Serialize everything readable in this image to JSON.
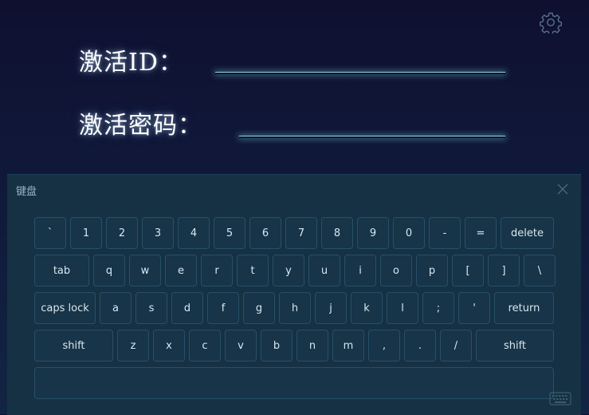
{
  "form": {
    "activation_id_label": "激活ID：",
    "activation_password_label": "激活密码：",
    "activation_id_value": "",
    "activation_password_value": ""
  },
  "icons": {
    "settings": "gear-icon",
    "close": "close-icon",
    "keyboard": "keyboard-icon"
  },
  "keyboard": {
    "title": "键盘",
    "row1": [
      "`",
      "1",
      "2",
      "3",
      "4",
      "5",
      "6",
      "7",
      "8",
      "9",
      "0",
      "-",
      "=",
      "delete"
    ],
    "row2": [
      "tab",
      "q",
      "w",
      "e",
      "r",
      "t",
      "y",
      "u",
      "i",
      "o",
      "p",
      "[",
      "]",
      "\\"
    ],
    "row3": [
      "caps lock",
      "a",
      "s",
      "d",
      "f",
      "g",
      "h",
      "j",
      "k",
      "l",
      ";",
      "'",
      "return"
    ],
    "row4": [
      "shift",
      "z",
      "x",
      "c",
      "v",
      "b",
      "n",
      "m",
      ",",
      ".",
      "/",
      "shift"
    ],
    "space": ""
  },
  "colors": {
    "background_top": "#0f1030",
    "keyboard_panel": "#163143",
    "key_border": "#27506a",
    "underline": "#8fd9da",
    "key_text": "#d9e6ee"
  }
}
